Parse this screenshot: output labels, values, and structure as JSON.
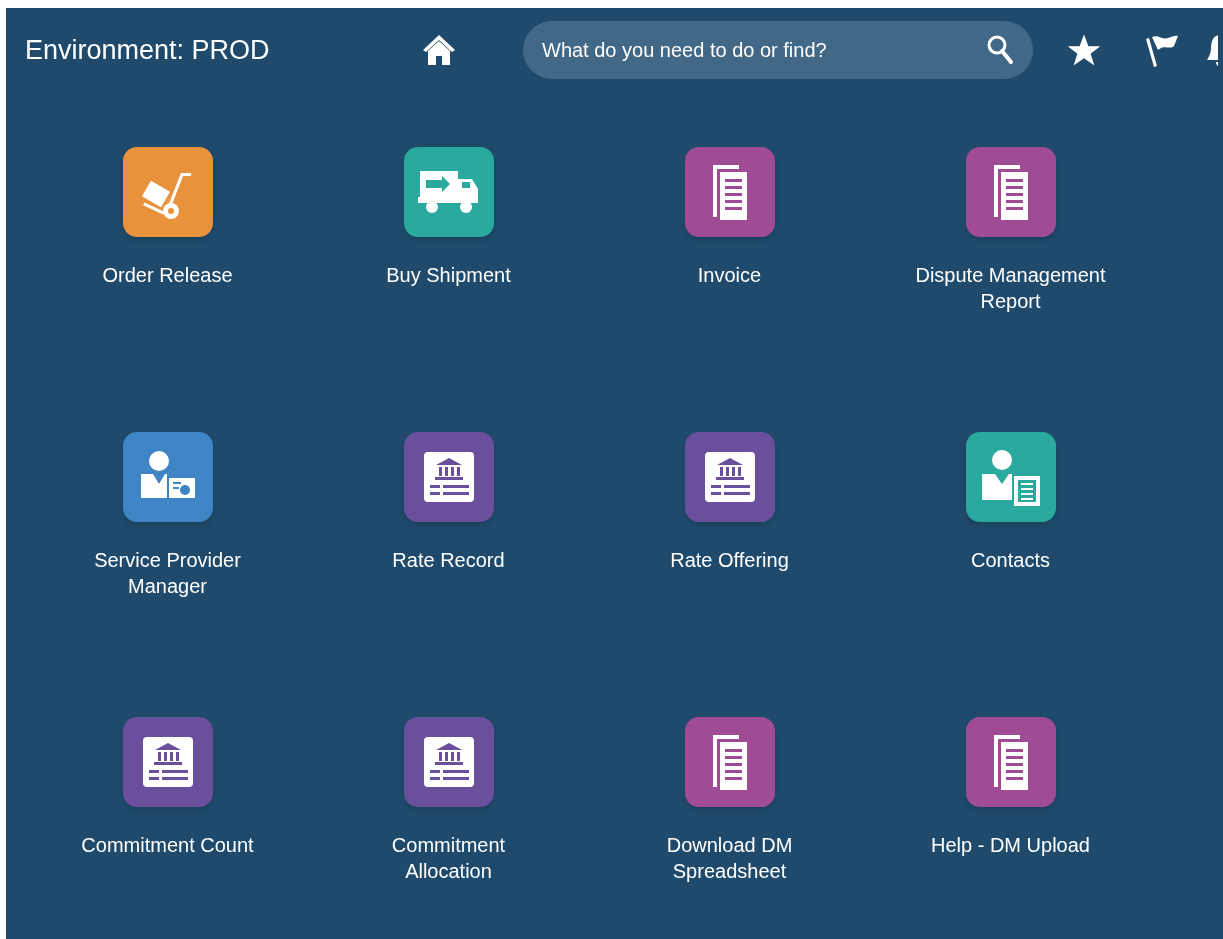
{
  "header": {
    "title": "Environment: PROD",
    "search": {
      "placeholder": "What do you need to do or find?"
    }
  },
  "tiles": [
    {
      "label": "Order Release",
      "kind": "cart"
    },
    {
      "label": "Buy Shipment",
      "kind": "truck"
    },
    {
      "label": "Invoice",
      "kind": "document"
    },
    {
      "label": "Dispute Management Report",
      "kind": "document"
    },
    {
      "label": "Service Provider Manager",
      "kind": "person-certificate"
    },
    {
      "label": "Rate Record",
      "kind": "bank"
    },
    {
      "label": "Rate Offering",
      "kind": "bank"
    },
    {
      "label": "Contacts",
      "kind": "person-document"
    },
    {
      "label": "Commitment Count",
      "kind": "bank"
    },
    {
      "label": "Commitment Allocation",
      "kind": "bank"
    },
    {
      "label": "Download DM Spreadsheet",
      "kind": "document"
    },
    {
      "label": "Help - DM Upload",
      "kind": "document"
    }
  ]
}
